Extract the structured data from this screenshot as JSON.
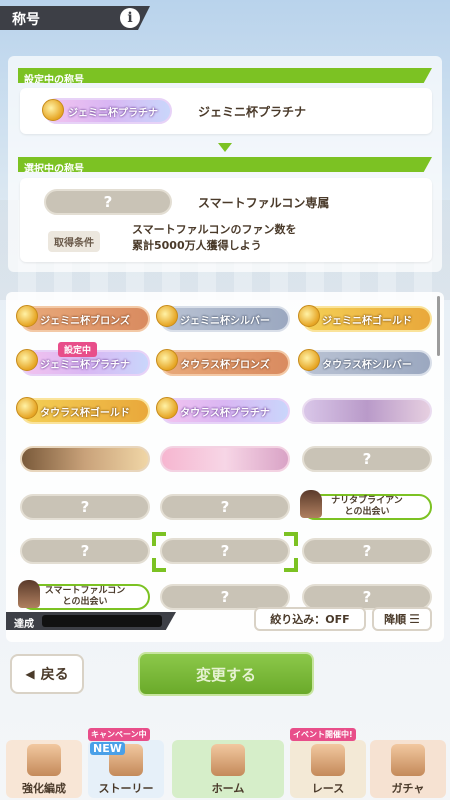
{
  "header": {
    "title": "称号",
    "info_glyph": "i"
  },
  "current": {
    "section_label": "設定中の称号",
    "badge_text": "ジェミニ杯プラチナ",
    "name": "ジェミニ杯プラチナ"
  },
  "selected": {
    "section_label": "選択中の称号",
    "badge_text": "?",
    "name": "スマートファルコン専属",
    "cond_label": "取得条件",
    "cond_line1": "スマートファルコンのファン数を",
    "cond_line2": "累計5000万人獲得しよう"
  },
  "titles": [
    {
      "text": "ジェミニ杯ブロンズ",
      "style": "bronze"
    },
    {
      "text": "ジェミニ杯シルバー",
      "style": "silver"
    },
    {
      "text": "ジェミニ杯ゴールド",
      "style": "gold"
    },
    {
      "text": "ジェミニ杯プラチナ",
      "style": "plat",
      "tag": "設定中"
    },
    {
      "text": "タウラス杯ブロンズ",
      "style": "bronze"
    },
    {
      "text": "タウラス杯シルバー",
      "style": "silver"
    },
    {
      "text": "タウラス杯ゴールド",
      "style": "gold"
    },
    {
      "text": "タウラス杯プラチナ",
      "style": "plat"
    },
    {
      "text": "",
      "style": "img3"
    },
    {
      "text": "",
      "style": "img"
    },
    {
      "text": "",
      "style": "img2"
    },
    {
      "text": "?",
      "style": "unk"
    },
    {
      "text": "?",
      "style": "unk"
    },
    {
      "text": "?",
      "style": "unk"
    },
    {
      "text": "ナリタブライアン\nとの出会い",
      "style": "meet"
    },
    {
      "text": "?",
      "style": "unk"
    },
    {
      "text": "?",
      "style": "unk"
    },
    {
      "text": "?",
      "style": "unk"
    },
    {
      "text": "スマートファルコン\nとの出会い",
      "style": "meet"
    },
    {
      "text": "?",
      "style": "unk"
    },
    {
      "text": "?",
      "style": "unk"
    }
  ],
  "achieve_label": "達成",
  "filter_label": "絞り込み：OFF",
  "sort_label": "降順",
  "back_label": "戻る",
  "change_label": "変更する",
  "nav": [
    {
      "label": "強化編成",
      "icon": "horse-girl-icon"
    },
    {
      "label": "ストーリー",
      "icon": "book-icon",
      "badge": "キャンペーン中",
      "new": "NEW"
    },
    {
      "label": "ホーム",
      "icon": "school-building-icon"
    },
    {
      "label": "レース",
      "icon": "race-flag-icon",
      "badge": "イベント開催中!"
    },
    {
      "label": "ガチャ",
      "icon": "gacha-door-icon"
    }
  ],
  "colors": {
    "accent_green": "#7cc223",
    "header_dark": "#3d3f46"
  }
}
